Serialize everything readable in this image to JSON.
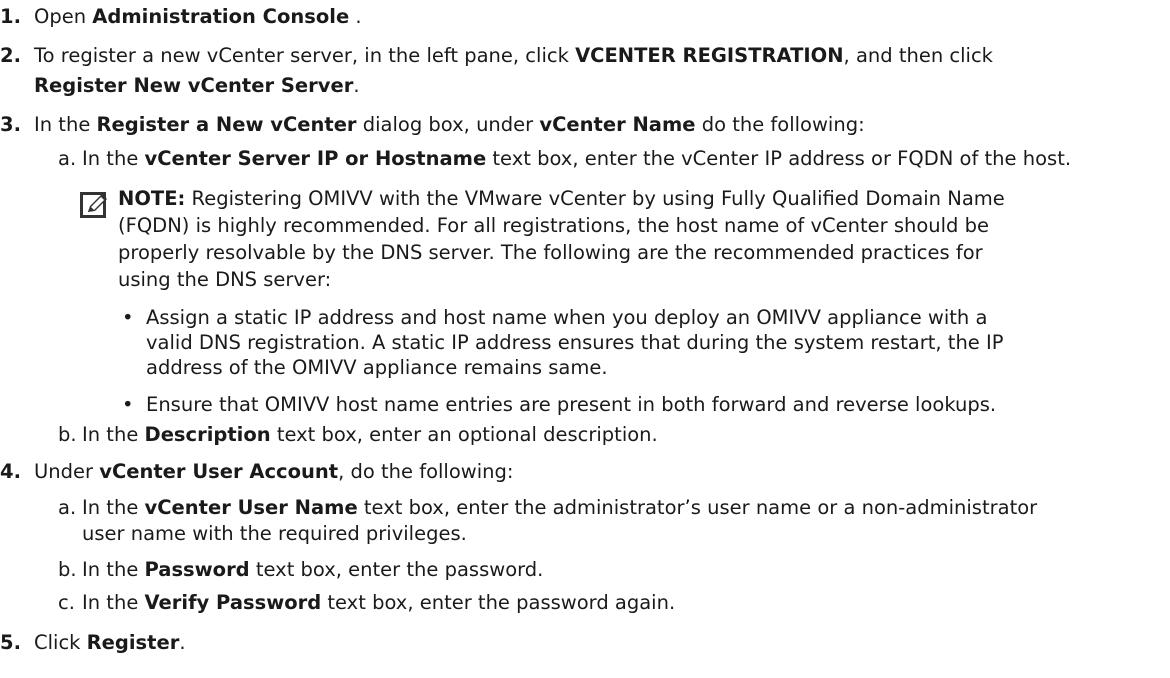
{
  "steps": [
    {
      "num": "1.",
      "pre": "Open ",
      "b1": "Administration Console",
      "post": " ."
    },
    {
      "num": "2.",
      "pre": "To register a new vCenter server, in the left pane, click ",
      "b1": "VCENTER REGISTRATION",
      "mid": ", and then click",
      "b2": "Register New vCenter Server",
      "post": "."
    },
    {
      "num": "3.",
      "pre": "In the ",
      "b1": "Register a New vCenter",
      "mid": " dialog box, under ",
      "b2": "vCenter Name",
      "post": " do the following:"
    },
    {
      "num": "4.",
      "pre": "Under ",
      "b1": "vCenter User Account",
      "post": ", do the following:"
    },
    {
      "num": "5.",
      "pre": "Click ",
      "b1": "Register",
      "post": "."
    }
  ],
  "step3_sub": [
    {
      "letter": "a.",
      "pre": "In the ",
      "b1": "vCenter Server IP or Hostname",
      "post": " text box, enter the vCenter IP address or FQDN of the host."
    },
    {
      "letter": "b.",
      "pre": "In the ",
      "b1": "Description",
      "post": " text box, enter an optional description."
    }
  ],
  "note": {
    "label": "NOTE:",
    "line1": " Registering OMIVV with the VMware vCenter by using Fully Qualified Domain Name",
    "line2": "(FQDN) is highly recommended. For all registrations, the host name of vCenter should be",
    "line3": "properly resolvable by the DNS server. The following are the recommended practices for",
    "line4": "using the DNS server:",
    "bullets": [
      {
        "line1": "Assign a static IP address and host name when you deploy an OMIVV appliance with a",
        "line2": "valid DNS registration. A static IP address ensures that during the system restart, the IP",
        "line3": "address of the OMIVV appliance remains same."
      },
      {
        "line1": "Ensure that OMIVV host name entries are present in both forward and reverse lookups."
      }
    ],
    "bullet_char": "•",
    "icon": "pencil-note-icon"
  },
  "step4_sub": [
    {
      "letter": "a.",
      "pre": "In the ",
      "b1": "vCenter User Name",
      "post": " text box, enter the administrator’s user name or a non-administrator",
      "line2": "user name with the required privileges."
    },
    {
      "letter": "b.",
      "pre": "In the ",
      "b1": "Password",
      "post": " text box, enter the password."
    },
    {
      "letter": "c.",
      "pre": "In the ",
      "b1": "Verify Password",
      "post": " text box, enter the password again."
    }
  ]
}
